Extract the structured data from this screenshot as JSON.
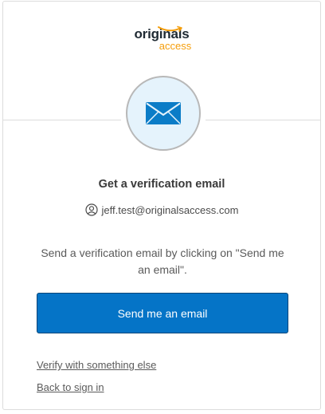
{
  "logo": {
    "line1": "originals",
    "line2": "access"
  },
  "icons": {
    "header": "envelope-icon",
    "user": "user-circle-icon"
  },
  "colors": {
    "brand_orange": "#f59e0b",
    "primary_button": "#0574c7",
    "icon_circle_bg": "#e5f3fc",
    "envelope": "#0b7cc7"
  },
  "main": {
    "title": "Get a verification email",
    "email": "jeff.test@originalsaccess.com",
    "description": "Send a verification email by clicking on \"Send me an email\".",
    "send_button_label": "Send me an email"
  },
  "links": {
    "verify_other": "Verify with something else",
    "back_to_sign_in": "Back to sign in"
  }
}
